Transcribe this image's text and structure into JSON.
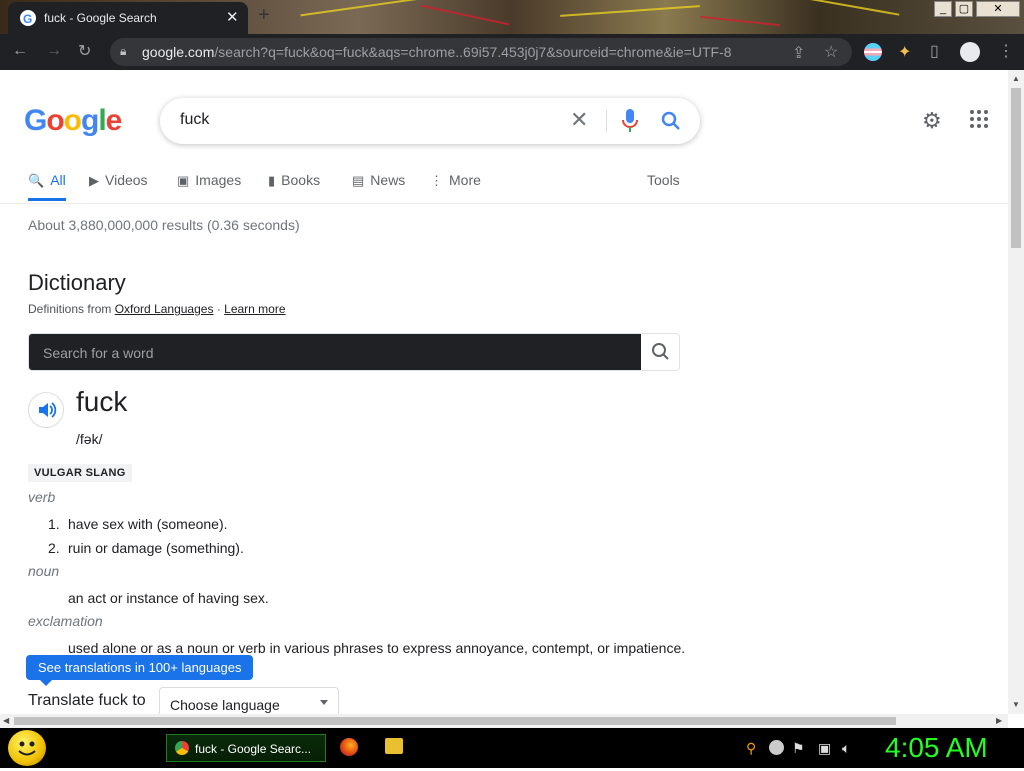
{
  "browser": {
    "tab_title": "fuck - Google Search",
    "tab_close": "✕",
    "new_tab": "+",
    "url_host": "google.com",
    "url_path": "/search?q=fuck&oq=fuck&aqs=chrome..69i57.453j0j7&sourceid=chrome&ie=UTF-8",
    "window_buttons": [
      "_",
      "▢",
      "✕"
    ]
  },
  "header": {
    "logo_letters": [
      {
        "ch": "G",
        "color": "#4285F4"
      },
      {
        "ch": "o",
        "color": "#EA4335"
      },
      {
        "ch": "o",
        "color": "#FBBC05"
      },
      {
        "ch": "g",
        "color": "#4285F4"
      },
      {
        "ch": "l",
        "color": "#34A853"
      },
      {
        "ch": "e",
        "color": "#EA4335"
      }
    ],
    "query": "fuck"
  },
  "tabs": [
    {
      "label": "All",
      "icon": "🔍",
      "active": true
    },
    {
      "label": "Videos",
      "icon": "▶"
    },
    {
      "label": "Images",
      "icon": "▣"
    },
    {
      "label": "Books",
      "icon": "▮"
    },
    {
      "label": "News",
      "icon": "▤"
    },
    {
      "label": "More",
      "icon": "⋮"
    },
    {
      "label": "Tools"
    }
  ],
  "results": {
    "stats": "About 3,880,000,000 results (0.36 seconds)"
  },
  "dictionary": {
    "title": "Dictionary",
    "source_prefix": "Definitions from",
    "source_name": "Oxford Languages",
    "separator": "·",
    "learn_more": "Learn more",
    "search_placeholder": "Search for a word",
    "word": "fuck",
    "phonetic": "/fək/",
    "register": "VULGAR SLANG",
    "senses": [
      {
        "pos": "verb",
        "defs": [
          "have sex with (someone).",
          "ruin or damage (something)."
        ],
        "numbers": [
          "1.",
          "2."
        ]
      },
      {
        "pos": "noun",
        "defs": [
          "an act or instance of having sex."
        ]
      },
      {
        "pos": "exclamation",
        "defs": [
          "used alone or as a noun or verb in various phrases to express annoyance, contempt, or impatience."
        ]
      }
    ],
    "translate_banner": "See translations in 100+ languages",
    "translate_label": "Translate fuck to",
    "language_select": "Choose language"
  },
  "taskbar": {
    "task_label": "fuck - Google Searc...",
    "clock": "4:05 AM"
  },
  "colors": {
    "accent_blue": "#1a73e8",
    "clock_green": "#22ff22"
  }
}
